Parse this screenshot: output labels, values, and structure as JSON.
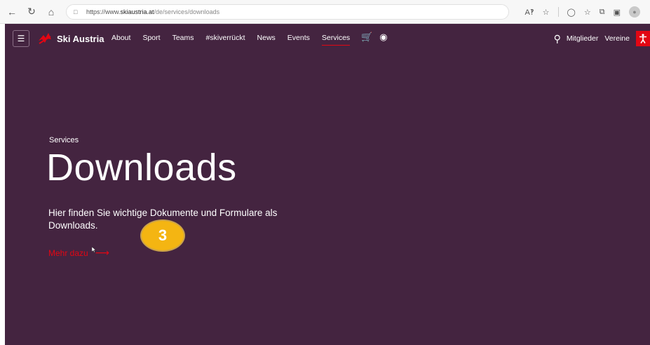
{
  "browser": {
    "url_prefix": "https://www.",
    "url_domain": "skiaustria.at",
    "url_path": "/de/services/downloads"
  },
  "site": {
    "logo_text": "Ski Austria",
    "nav": [
      {
        "label": "About"
      },
      {
        "label": "Sport"
      },
      {
        "label": "Teams"
      },
      {
        "label": "#skiverrückt"
      },
      {
        "label": "News"
      },
      {
        "label": "Events"
      },
      {
        "label": "Services",
        "active": true
      }
    ],
    "header_links": {
      "members": "Mitglieder",
      "clubs": "Vereine"
    },
    "colors": {
      "background": "#442440",
      "accent": "#e30613"
    }
  },
  "hero": {
    "eyebrow": "Services",
    "title": "Downloads",
    "description": "Hier finden Sie wichtige Dokumente und Formulare als Downloads.",
    "cta_label": "Mehr dazu"
  },
  "annotation": {
    "step_number": "3"
  }
}
